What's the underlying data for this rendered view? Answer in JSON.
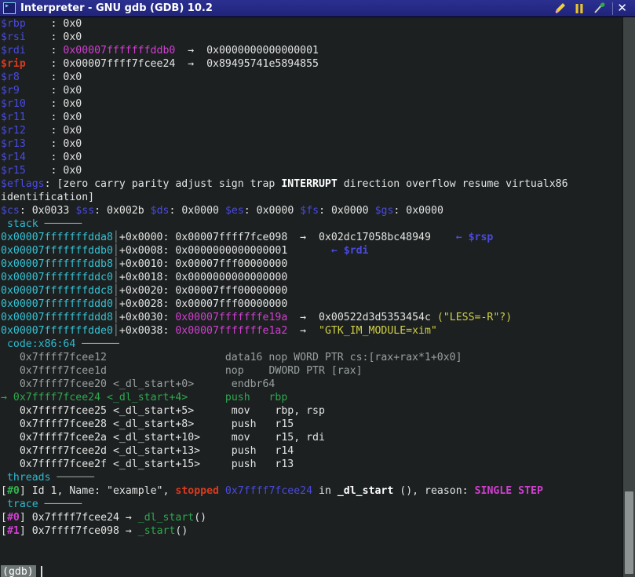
{
  "window": {
    "title": "Interpreter - GNU gdb (GDB) 10.2",
    "icon": "terminal-icon",
    "buttons": [
      {
        "name": "pencil-icon",
        "glyph": "✎"
      },
      {
        "name": "pause-icon",
        "glyph": "⏸"
      },
      {
        "name": "hammer-icon",
        "glyph": "⚒"
      },
      {
        "name": "close-icon",
        "glyph": "✕"
      }
    ]
  },
  "registers": [
    {
      "name": "$rbp",
      "value": "0x0"
    },
    {
      "name": "$rsi",
      "value": "0x0"
    },
    {
      "name": "$rdi",
      "value": "0x00007fffffffddb0",
      "arrow": "→",
      "deref": "0x0000000000000001",
      "value_color": "ptr"
    },
    {
      "name": "$rip",
      "value": "0x00007ffff7fcee24",
      "arrow": "→",
      "deref": "0x89495741e5894855",
      "highlight": true
    },
    {
      "name": "$r8",
      "value": "0x0"
    },
    {
      "name": "$r9",
      "value": "0x0"
    },
    {
      "name": "$r10",
      "value": "0x0"
    },
    {
      "name": "$r11",
      "value": "0x0"
    },
    {
      "name": "$r12",
      "value": "0x0"
    },
    {
      "name": "$r13",
      "value": "0x0"
    },
    {
      "name": "$r14",
      "value": "0x0"
    },
    {
      "name": "$r15",
      "value": "0x0"
    }
  ],
  "eflags": {
    "label": "$eflags",
    "prefix": "[",
    "flags_before": "zero carry parity adjust sign trap ",
    "flag_set": "INTERRUPT",
    "flags_after": " direction overflow resume virtualx86",
    "wrap": "identification]"
  },
  "segments": [
    {
      "name": "$cs",
      "value": "0x0033"
    },
    {
      "name": "$ss",
      "value": "0x002b"
    },
    {
      "name": "$ds",
      "value": "0x0000"
    },
    {
      "name": "$es",
      "value": "0x0000"
    },
    {
      "name": "$fs",
      "value": "0x0000"
    },
    {
      "name": "$gs",
      "value": "0x0000"
    }
  ],
  "sections": {
    "stack": "stack",
    "code": "code:x86:64",
    "threads": "threads",
    "trace": "trace"
  },
  "stack": [
    {
      "addr": "0x00007fffffffdda8",
      "offset": "+0x0000:",
      "value": "0x00007ffff7fce098",
      "arrow": "→",
      "deref": "0x02dc17058bc48949",
      "marker": "← $rsp"
    },
    {
      "addr": "0x00007fffffffddb0",
      "offset": "+0x0008:",
      "value": "0x0000000000000001",
      "marker": "← $rdi"
    },
    {
      "addr": "0x00007fffffffddb8",
      "offset": "+0x0010:",
      "value": "0x00007fff00000000"
    },
    {
      "addr": "0x00007fffffffddc0",
      "offset": "+0x0018:",
      "value": "0x0000000000000000"
    },
    {
      "addr": "0x00007fffffffddc8",
      "offset": "+0x0020:",
      "value": "0x00007fff00000000"
    },
    {
      "addr": "0x00007fffffffddd0",
      "offset": "+0x0028:",
      "value": "0x00007fff00000000"
    },
    {
      "addr": "0x00007fffffffddd8",
      "offset": "+0x0030:",
      "value": "0x00007fffffffe19a",
      "value_color": "ptr",
      "arrow": "→",
      "deref": "0x00522d3d5353454c",
      "string": "(\"LESS=-R\"?)"
    },
    {
      "addr": "0x00007fffffffdde0",
      "offset": "+0x0038:",
      "value": "0x00007fffffffe1a2",
      "value_color": "ptr",
      "arrow": "→",
      "string": "\"GTK_IM_MODULE=xim\""
    }
  ],
  "code": [
    {
      "marker": "",
      "addr": "0x7ffff7fcee12",
      "sym": "",
      "mnemonic": "data16 nop WORD PTR cs:[rax+rax*1+0x0]",
      "operands": "",
      "current": false
    },
    {
      "marker": "",
      "addr": "0x7ffff7fcee1d",
      "sym": "",
      "mnemonic": "nop",
      "operands": "DWORD PTR [rax]",
      "current": false
    },
    {
      "marker": "",
      "addr": "0x7ffff7fcee20",
      "sym": "<_dl_start+0>",
      "mnemonic": "endbr64",
      "operands": "",
      "current": false
    },
    {
      "marker": "→",
      "addr": "0x7ffff7fcee24",
      "sym": "<_dl_start+4>",
      "mnemonic": "push",
      "operands": "rbp",
      "current": true
    },
    {
      "marker": "",
      "addr": "0x7ffff7fcee25",
      "sym": "<_dl_start+5>",
      "mnemonic": "mov",
      "operands": "rbp, rsp",
      "current": false
    },
    {
      "marker": "",
      "addr": "0x7ffff7fcee28",
      "sym": "<_dl_start+8>",
      "mnemonic": "push",
      "operands": "r15",
      "current": false
    },
    {
      "marker": "",
      "addr": "0x7ffff7fcee2a",
      "sym": "<_dl_start+10>",
      "mnemonic": "mov",
      "operands": "r15, rdi",
      "current": false
    },
    {
      "marker": "",
      "addr": "0x7ffff7fcee2d",
      "sym": "<_dl_start+13>",
      "mnemonic": "push",
      "operands": "r14",
      "current": false
    },
    {
      "marker": "",
      "addr": "0x7ffff7fcee2f",
      "sym": "<_dl_start+15>",
      "mnemonic": "push",
      "operands": "r13",
      "current": false
    }
  ],
  "threads": {
    "index": "#0",
    "id_text": "Id 1, Name: ",
    "name": "\"example\",",
    "state": "stopped",
    "addr": "0x7ffff7fcee24",
    "in_text": "in",
    "func": "_dl_start",
    "parens": "(), reason:",
    "reason": "SINGLE STEP"
  },
  "trace": [
    {
      "index": "#0",
      "addr": "0x7ffff7fcee24",
      "arrow": "→",
      "func": "_dl_start",
      "parens": "()"
    },
    {
      "index": "#1",
      "addr": "0x7ffff7fce098",
      "arrow": "→",
      "func": "_start",
      "parens": "()"
    }
  ],
  "prompt": {
    "label": "(gdb)",
    "input": ""
  },
  "colors": {
    "background": "#1c2020",
    "titlebar": "#262a86",
    "register": "#4a4ae0",
    "rip": "#d83a1e",
    "pointer": "#d23fd2",
    "section": "#2fb9cf",
    "string": "#d0d046",
    "current_line": "#2fa84f"
  }
}
